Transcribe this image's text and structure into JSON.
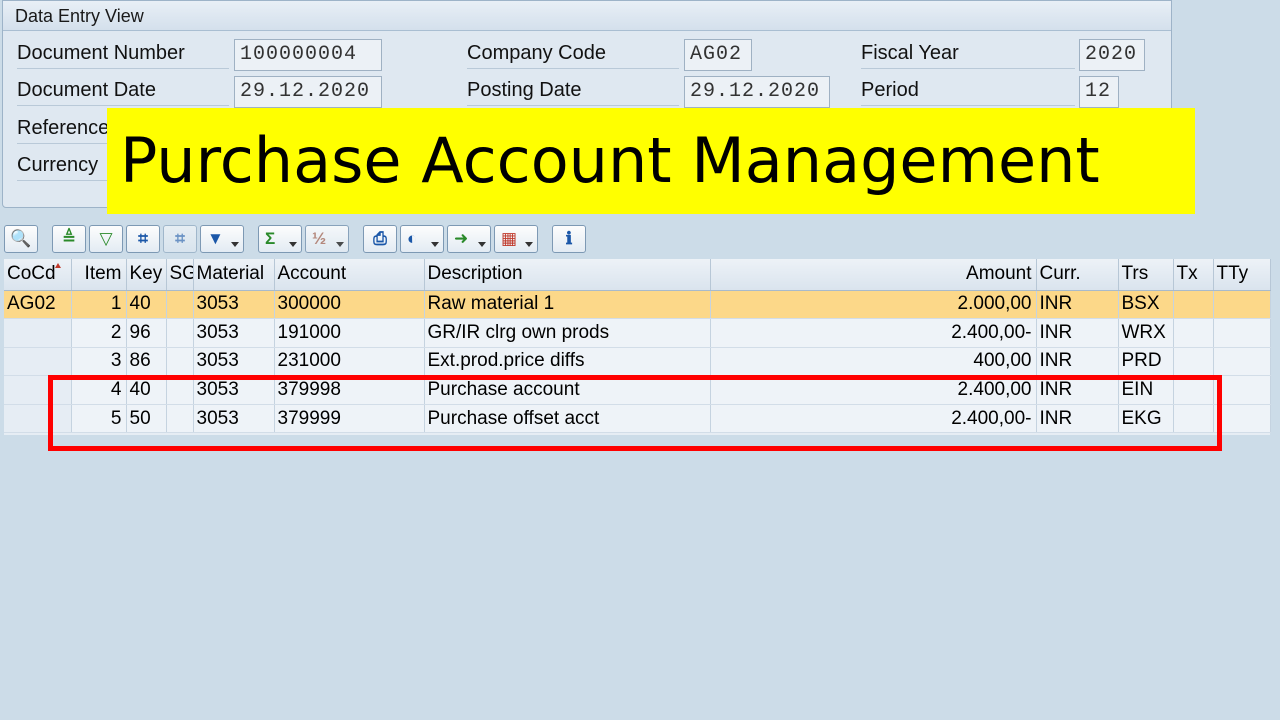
{
  "panel": {
    "title": "Data Entry View",
    "fields": {
      "document_number": {
        "label": "Document Number",
        "value": "100000004"
      },
      "company_code": {
        "label": "Company Code",
        "value": "AG02"
      },
      "fiscal_year": {
        "label": "Fiscal Year",
        "value": "2020"
      },
      "document_date": {
        "label": "Document Date",
        "value": "29.12.2020"
      },
      "posting_date": {
        "label": "Posting Date",
        "value": "29.12.2020"
      },
      "period": {
        "label": "Period",
        "value": "12"
      },
      "reference": {
        "label": "Reference"
      },
      "currency": {
        "label": "Currency"
      }
    }
  },
  "banner": {
    "text": "Purchase Account Management"
  },
  "toolbar": {
    "icons": [
      "details-icon",
      "sort-ascending-icon",
      "sort-descending-icon",
      "find-icon",
      "find-next-icon",
      "filter-icon",
      "total-icon",
      "subtotal-icon",
      "print-icon",
      "view-icon",
      "export-icon",
      "layout-icon",
      "info-icon"
    ]
  },
  "table": {
    "columns": {
      "cocd": "CoCd",
      "item": "Item",
      "key": "Key",
      "sg": "SG",
      "material": "Material",
      "account": "Account",
      "description": "Description",
      "amount": "Amount",
      "curr": "Curr.",
      "trs": "Trs",
      "tx": "Tx",
      "tty": "TTy"
    },
    "rows": [
      {
        "cocd": "AG02",
        "item": "1",
        "key": "40",
        "sg": "",
        "material": "3053",
        "account": "300000",
        "description": "Raw material 1",
        "amount": "2.000,00",
        "curr": "INR",
        "trs": "BSX",
        "tx": "",
        "tty": ""
      },
      {
        "cocd": "",
        "item": "2",
        "key": "96",
        "sg": "",
        "material": "3053",
        "account": "191000",
        "description": "GR/IR clrg own prods",
        "amount": "2.400,00-",
        "curr": "INR",
        "trs": "WRX",
        "tx": "",
        "tty": ""
      },
      {
        "cocd": "",
        "item": "3",
        "key": "86",
        "sg": "",
        "material": "3053",
        "account": "231000",
        "description": "Ext.prod.price diffs",
        "amount": "400,00",
        "curr": "INR",
        "trs": "PRD",
        "tx": "",
        "tty": ""
      },
      {
        "cocd": "",
        "item": "4",
        "key": "40",
        "sg": "",
        "material": "3053",
        "account": "379998",
        "description": "Purchase account",
        "amount": "2.400,00",
        "curr": "INR",
        "trs": "EIN",
        "tx": "",
        "tty": ""
      },
      {
        "cocd": "",
        "item": "5",
        "key": "50",
        "sg": "",
        "material": "3053",
        "account": "379999",
        "description": "Purchase offset acct",
        "amount": "2.400,00-",
        "curr": "INR",
        "trs": "EKG",
        "tx": "",
        "tty": ""
      }
    ]
  },
  "colors": {
    "banner": "#ffff00",
    "highlight": "#ff0000",
    "selected_row": "#fcd889",
    "background": "#ccdce8"
  }
}
